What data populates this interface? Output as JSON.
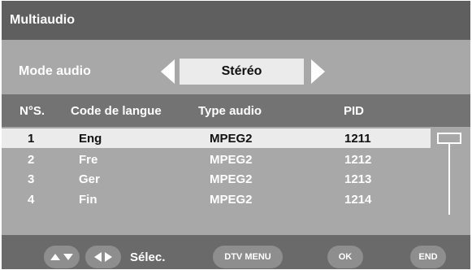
{
  "title": "Multiaudio",
  "mode": {
    "label": "Mode audio",
    "value": "Stéréo"
  },
  "table": {
    "headers": {
      "num": "N°S.",
      "lang": "Code de langue",
      "type": "Type audio",
      "pid": "PID"
    },
    "rows": [
      {
        "num": "1",
        "lang": "Eng",
        "type": "MPEG2",
        "pid": "1211"
      },
      {
        "num": "2",
        "lang": "Fre",
        "type": "MPEG2",
        "pid": "1212"
      },
      {
        "num": "3",
        "lang": "Ger",
        "type": "MPEG2",
        "pid": "1213"
      },
      {
        "num": "4",
        "lang": "Fin",
        "type": "MPEG2",
        "pid": "1214"
      }
    ]
  },
  "footer": {
    "select_label": "Sélec.",
    "dtv_menu": "DTV MENU",
    "ok": "OK",
    "end": "END"
  },
  "icons": {
    "up_down": "up-down-arrows-icon",
    "left_right": "left-right-arrows-icon"
  },
  "colors": {
    "background": "#a8a8a8",
    "title_bar": "#5f5f5f",
    "header_bar": "#737373",
    "selection": "#ebebeb",
    "footer": "#6a6a6a",
    "pill": "#8e8e8e"
  }
}
